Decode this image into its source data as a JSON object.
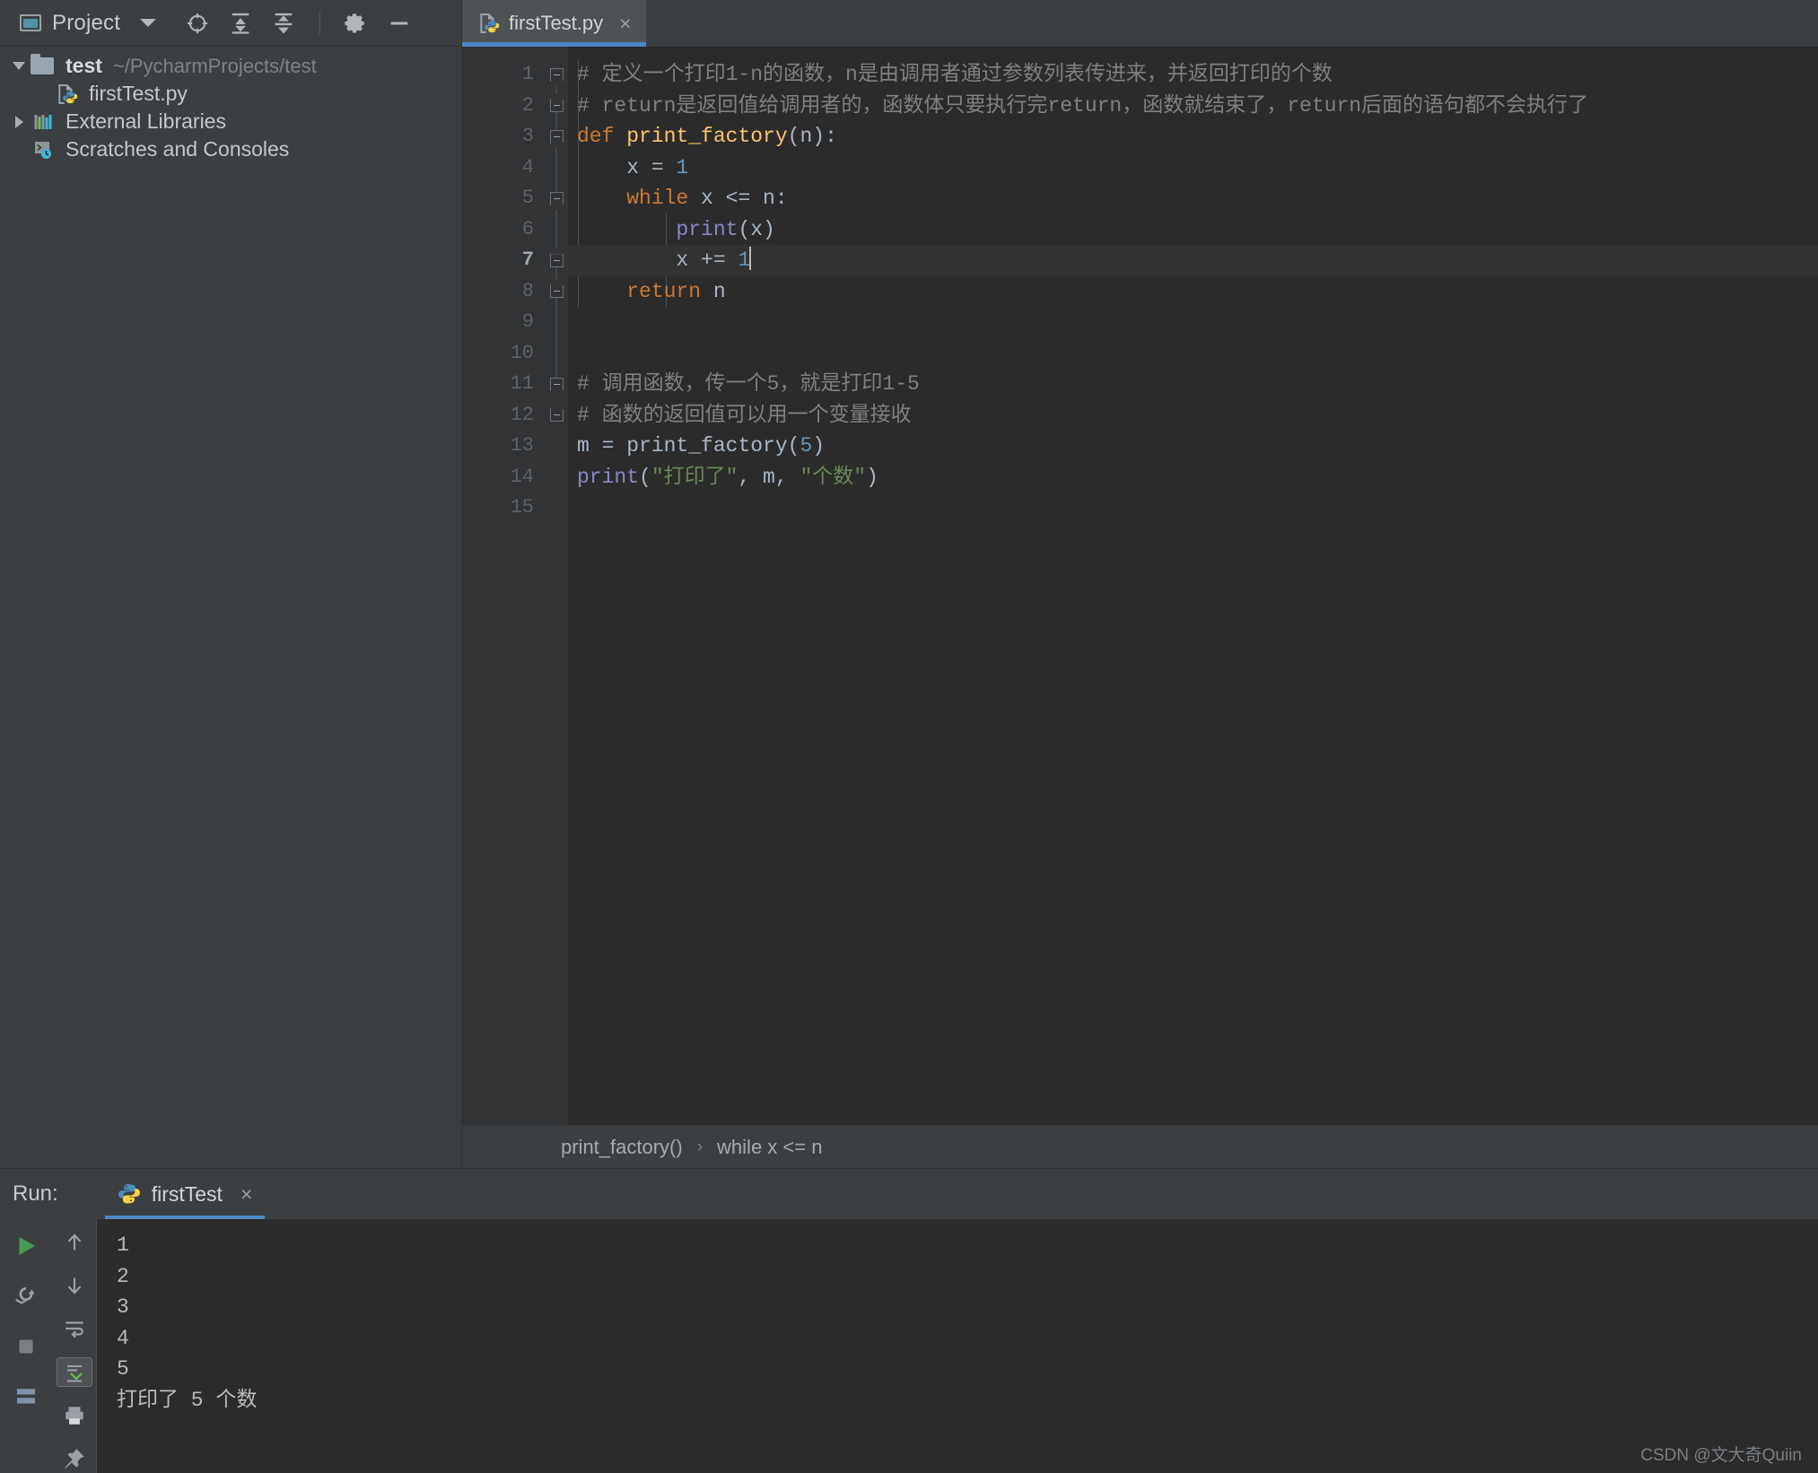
{
  "sidebar": {
    "header": {
      "title": "Project",
      "icons": [
        "project-panel-icon",
        "chevron-down-icon",
        "locate-target-icon",
        "expand-all-icon",
        "collapse-all-icon",
        "gear-icon",
        "minimize-icon"
      ]
    },
    "tree": [
      {
        "label": "test",
        "secondary": "~/PycharmProjects/test",
        "icon": "folder-icon",
        "twisty": "expanded",
        "depth": 0
      },
      {
        "label": "firstTest.py",
        "secondary": "",
        "icon": "python-file-icon",
        "twisty": "none",
        "depth": 1
      },
      {
        "label": "External Libraries",
        "secondary": "",
        "icon": "libraries-icon",
        "twisty": "collapsed",
        "depth": 0
      },
      {
        "label": "Scratches and Consoles",
        "secondary": "",
        "icon": "scratches-icon",
        "twisty": "none",
        "depth": 0
      }
    ]
  },
  "editor": {
    "tab": {
      "label": "firstTest.py",
      "icon": "python-file-icon",
      "close": "×"
    },
    "current_line": 7,
    "lines": [
      {
        "n": "1",
        "text": "# 定义一个打印1-n的函数，n是由调用者通过参数列表传进来，并返回打印的个数"
      },
      {
        "n": "2",
        "text": "# return是返回值给调用者的，函数体只要执行完return，函数就结束了，return后面的语句都不会执行了"
      },
      {
        "n": "3",
        "text": "def print_factory(n):"
      },
      {
        "n": "4",
        "text": "    x = 1"
      },
      {
        "n": "5",
        "text": "    while x <= n:"
      },
      {
        "n": "6",
        "text": "        print(x)"
      },
      {
        "n": "7",
        "text": "        x += 1"
      },
      {
        "n": "8",
        "text": "    return n"
      },
      {
        "n": "9",
        "text": ""
      },
      {
        "n": "10",
        "text": ""
      },
      {
        "n": "11",
        "text": "# 调用函数，传一个5，就是打印1-5"
      },
      {
        "n": "12",
        "text": "# 函数的返回值可以用一个变量接收"
      },
      {
        "n": "13",
        "text": "m = print_factory(5)"
      },
      {
        "n": "14",
        "text": "print(\"打印了\", m, \"个数\")"
      },
      {
        "n": "15",
        "text": ""
      }
    ],
    "breadcrumb": [
      "print_factory()",
      "while x <= n"
    ],
    "breadcrumb_separator": "›"
  },
  "run": {
    "label": "Run:",
    "tab_label": "firstTest",
    "tab_close": "×",
    "tools": [
      "run-icon",
      "rerun-icon",
      "stop-icon",
      "scroll-up-icon",
      "scroll-down-icon",
      "soft-wrap-icon",
      "scroll-to-end-icon",
      "print-icon",
      "pin-icon"
    ],
    "console": [
      "1",
      "2",
      "3",
      "4",
      "5",
      "打印了 5 个数"
    ]
  },
  "watermark": "CSDN @文大奇Quiin",
  "colors": {
    "accent": "#4a88c7",
    "keyword": "#cc7832",
    "function": "#ffc66d",
    "number": "#6897bb",
    "builtin": "#8888c6",
    "comment": "#808080",
    "string": "#6a8759",
    "text": "#a9b7c6",
    "editor_bg": "#2b2b2b",
    "panel_bg": "#3c3f41"
  }
}
